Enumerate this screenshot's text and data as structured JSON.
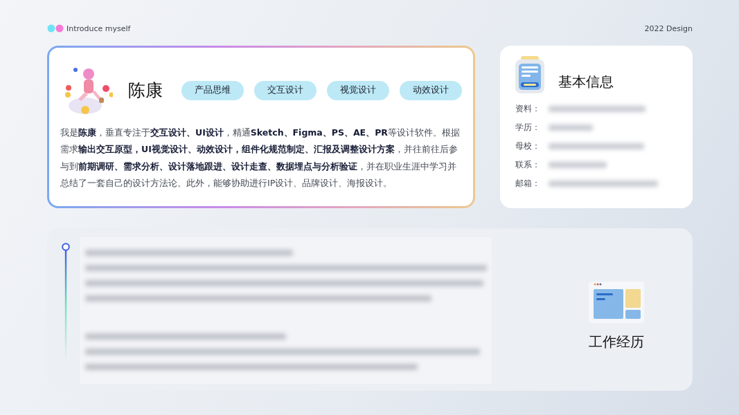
{
  "header": {
    "title": "Introduce myself",
    "year_label": "2022 Design"
  },
  "intro": {
    "name": "陈康",
    "tags": [
      "产品思维",
      "交互设计",
      "视觉设计",
      "动效设计"
    ],
    "bio": "我是**陈康**，垂直专注于**交互设计、UI设计**，精通**Sketch、Figma、PS、AE、PR**等设计软件。根据需求**输出交互原型，UI视觉设计、动效设计，组件化规范制定、汇报及调整设计方案**，并往前往后参与到**前期调研、需求分析、设计落地跟进、设计走查、数据埋点与分析验证**，并在职业生涯中学习并总结了一套自己的设计方法论。此外，能够协助进行IP设计、品牌设计、海报设计。"
  },
  "basic_info": {
    "title": "基本信息",
    "fields": [
      {
        "label": "资料："
      },
      {
        "label": "学历："
      },
      {
        "label": "母校："
      },
      {
        "label": "联系："
      },
      {
        "label": "邮箱："
      }
    ]
  },
  "work_experience": {
    "title": "工作经历"
  }
}
